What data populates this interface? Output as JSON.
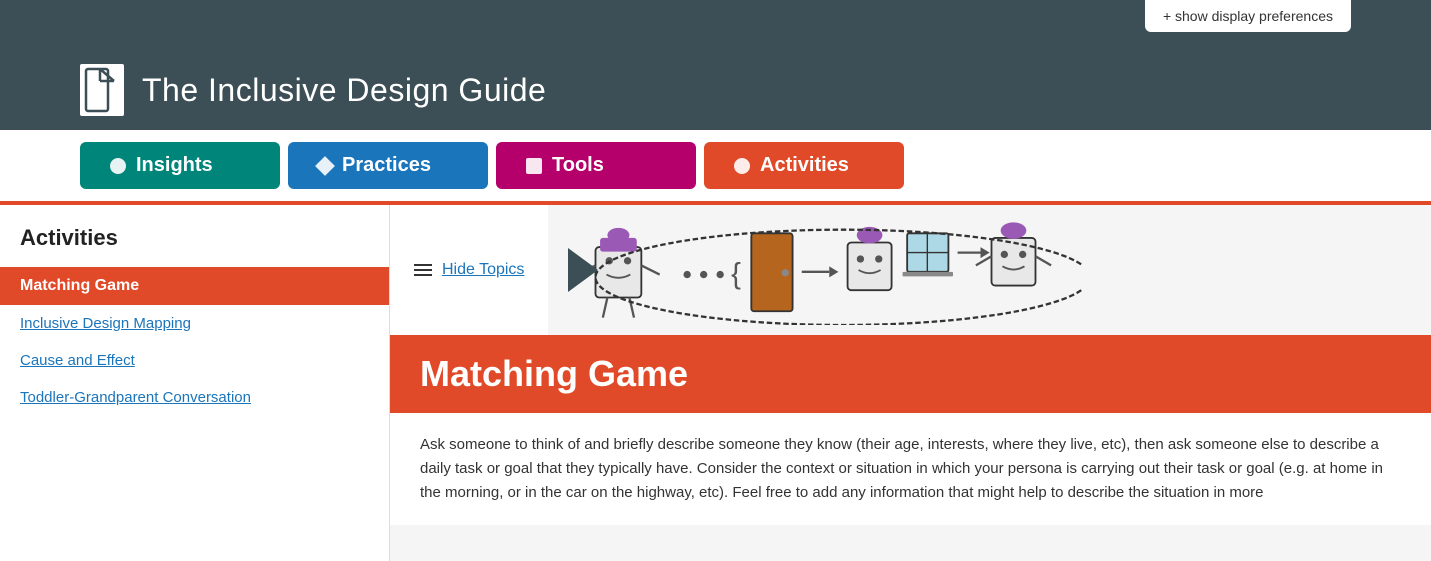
{
  "topbar": {
    "show_prefs_label": "+ show display preferences"
  },
  "header": {
    "site_title": "The Inclusive Design Guide",
    "logo_icon": "▶"
  },
  "nav": {
    "tabs": [
      {
        "id": "insights",
        "label": "Insights",
        "icon_type": "circle",
        "color": "#00857a"
      },
      {
        "id": "practices",
        "label": "Practices",
        "icon_type": "diamond",
        "color": "#1b75bb"
      },
      {
        "id": "tools",
        "label": "Tools",
        "icon_type": "square",
        "color": "#b5006b"
      },
      {
        "id": "activities",
        "label": "Activities",
        "icon_type": "circle",
        "color": "#e04a28",
        "active": true
      }
    ]
  },
  "sidebar": {
    "title": "Activities",
    "items": [
      {
        "id": "matching-game",
        "label": "Matching Game",
        "active": true
      },
      {
        "id": "inclusive-design-mapping",
        "label": "Inclusive Design Mapping",
        "active": false
      },
      {
        "id": "cause-and-effect",
        "label": "Cause and Effect",
        "active": false
      },
      {
        "id": "toddler-grandparent",
        "label": "Toddler-Grandparent Conversation",
        "active": false
      }
    ]
  },
  "content": {
    "hide_topics_label": "Hide Topics",
    "page_title": "Matching Game",
    "body_text": "Ask someone to think of and briefly describe someone they know (their age, interests, where they live, etc), then ask someone else to describe a daily task or goal that they typically have. Consider the context or situation in which your persona is carrying out their task or goal (e.g. at home in the morning, or in the car on the highway, etc). Feel free to add any information that might help to describe the situation in more"
  }
}
